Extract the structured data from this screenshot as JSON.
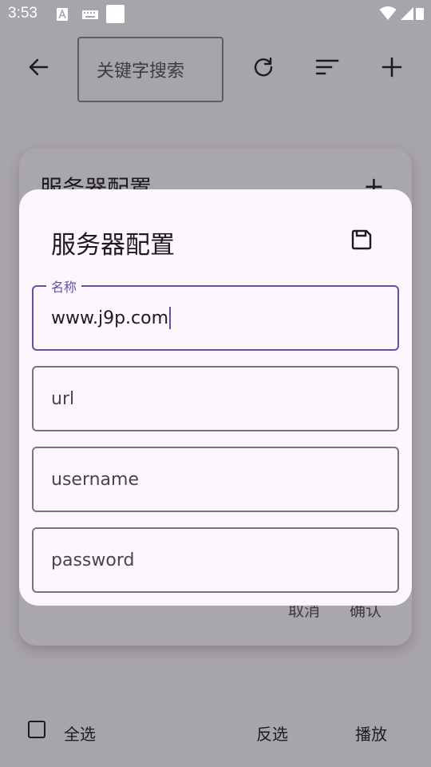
{
  "status_bar": {
    "time": "3:53"
  },
  "toolbar": {
    "search_placeholder": "关键字搜索"
  },
  "background_card": {
    "title": "服务器配置",
    "add_symbol": "+",
    "cancel_label": "取消",
    "confirm_label": "确认"
  },
  "dialog": {
    "title": "服务器配置",
    "fields": {
      "name": {
        "label": "名称",
        "value": "www.j9p.com"
      },
      "url": {
        "placeholder": "url"
      },
      "username": {
        "placeholder": "username"
      },
      "password": {
        "placeholder": "password"
      }
    }
  },
  "bottom_bar": {
    "select_all_label": "全选",
    "invert_label": "反选",
    "play_label": "播放"
  },
  "colors": {
    "primary": "#6750a4",
    "scrim": "#a8a4ab",
    "surface": "#fbf7fd"
  }
}
